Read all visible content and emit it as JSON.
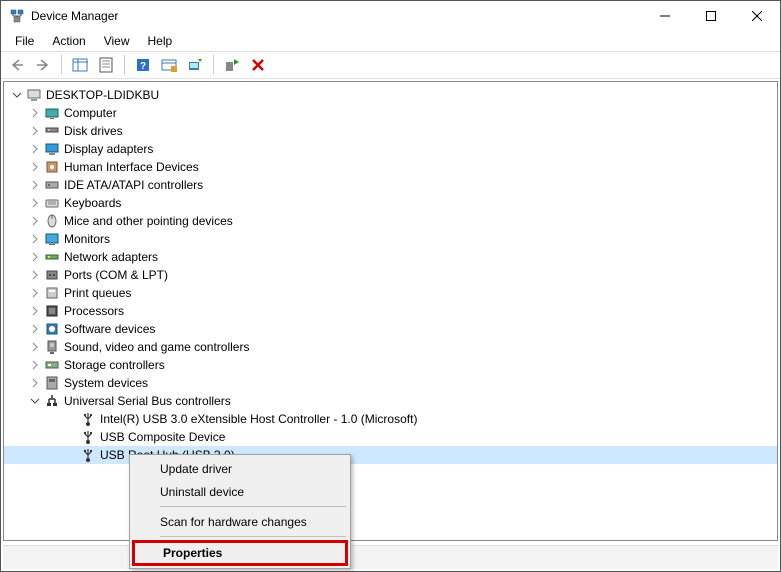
{
  "window": {
    "title": "Device Manager"
  },
  "menubar": {
    "file": "File",
    "action": "Action",
    "view": "View",
    "help": "Help"
  },
  "tree": {
    "root": "DESKTOP-LDIDKBU",
    "categories": [
      "Computer",
      "Disk drives",
      "Display adapters",
      "Human Interface Devices",
      "IDE ATA/ATAPI controllers",
      "Keyboards",
      "Mice and other pointing devices",
      "Monitors",
      "Network adapters",
      "Ports (COM & LPT)",
      "Print queues",
      "Processors",
      "Software devices",
      "Sound, video and game controllers",
      "Storage controllers",
      "System devices",
      "Universal Serial Bus controllers"
    ],
    "usb_children": [
      "Intel(R) USB 3.0 eXtensible Host Controller - 1.0 (Microsoft)",
      "USB Composite Device",
      "USB Root Hub (USB 3.0)"
    ]
  },
  "context_menu": {
    "update_driver": "Update driver",
    "uninstall_device": "Uninstall device",
    "scan": "Scan for hardware changes",
    "properties": "Properties"
  }
}
